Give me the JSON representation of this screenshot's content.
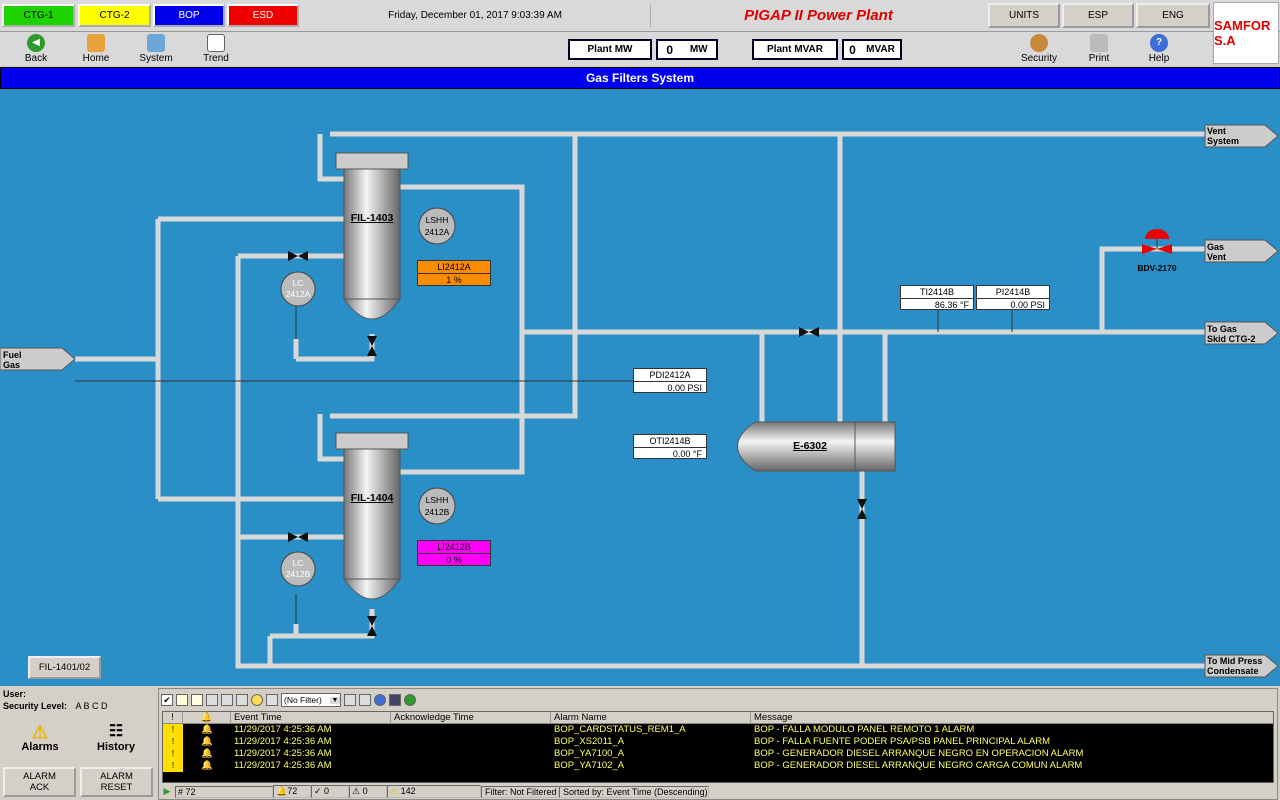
{
  "top": {
    "ctg1": "CTG-1",
    "ctg2": "CTG-2",
    "bop": "BOP",
    "esd": "ESD",
    "datetime": "Friday, December 01, 2017 9:03:39 AM",
    "plant_title": "PIGAP II Power Plant",
    "units": "UNITS",
    "esp": "ESP",
    "eng": "ENG",
    "logo": "SAMFOR S.A"
  },
  "nav": {
    "back": "Back",
    "home": "Home",
    "system": "System",
    "trend": "Trend",
    "security": "Security",
    "print": "Print",
    "help": "Help"
  },
  "plant": {
    "mw_label": "Plant MW",
    "mw_value": "0",
    "mw_unit": "MW",
    "mvar_label": "Plant MVAR",
    "mvar_value": "0",
    "mvar_unit": "MVAR"
  },
  "screen_title": "Gas Filters System",
  "diagram": {
    "fil1403": "FIL-1403",
    "fil1404": "FIL-1404",
    "e6302": "E-6302",
    "lshh_a_1": "LSHH",
    "lshh_a_2": "2412A",
    "lshh_b_1": "LSHH",
    "lshh_b_2": "2412B",
    "lc_a_1": "LC",
    "lc_a_2": "2412A",
    "lc_b_1": "LC",
    "lc_b_2": "2412B",
    "li_a_tag": "LI2412A",
    "li_a_val": "1  %",
    "li_b_tag": "LI2412B",
    "li_b_val": "0  %",
    "pdi_tag": "PDI2412A",
    "pdi_val": "0.00  PSI",
    "oti_tag": "OTI2414B",
    "oti_val": "0.00  °F",
    "ti_tag": "TI2414B",
    "ti_val": "86.36  °F",
    "pi_tag": "PI2414B",
    "pi_val": "0.00  PSI",
    "bdv": "BDV-2170",
    "fuel_1": "Fuel",
    "fuel_2": "Gas",
    "vent_1": "Vent",
    "vent_2": "System",
    "gasvent_1": "Gas",
    "gasvent_2": "Vent",
    "togas_1": "To Gas",
    "togas_2": "Skid CTG-2",
    "mid_1": "To Mid Press",
    "mid_2": "Condensate",
    "fil_btn": "FIL-1401/02"
  },
  "left": {
    "user": "User:",
    "sec_label": "Security Level:",
    "sec_levels": "A  B  C  D",
    "alarms": "Alarms",
    "history": "History",
    "ack": "ALARM\nACK",
    "reset": "ALARM\nRESET"
  },
  "alarm_panel": {
    "filter_select": "(No Filter)",
    "headers": [
      "!",
      "",
      "Event Time",
      "Acknowledge Time",
      "Alarm Name",
      "Message"
    ],
    "rows": [
      {
        "time": "11/29/2017 4:25:36 AM",
        "ack": "",
        "name": "BOP_CARDSTATUS_REM1_A",
        "msg": "BOP - FALLA MODULO PANEL REMOTO 1 ALARM"
      },
      {
        "time": "11/29/2017 4:25:36 AM",
        "ack": "",
        "name": "BOP_XS2011_A",
        "msg": "BOP - FALLA FUENTE PODER PSA/PSB PANEL PRINCIPAL ALARM"
      },
      {
        "time": "11/29/2017 4:25:36 AM",
        "ack": "",
        "name": "BOP_YA7100_A",
        "msg": "BOP - GENERADOR DIESEL ARRANQUE NEGRO EN OPERACION ALARM"
      },
      {
        "time": "11/29/2017 4:25:36 AM",
        "ack": "",
        "name": "BOP_YA7102_A",
        "msg": "BOP - GENERADOR DIESEL ARRANQUE NEGRO CARGA COMUN ALARM"
      }
    ],
    "status": {
      "count": "72",
      "bell": "72",
      "check": "0",
      "zero": "0",
      "warn": "142",
      "filter": "Filter: Not Filtered",
      "sorted": "Sorted by: Event Time (Descending)"
    }
  }
}
